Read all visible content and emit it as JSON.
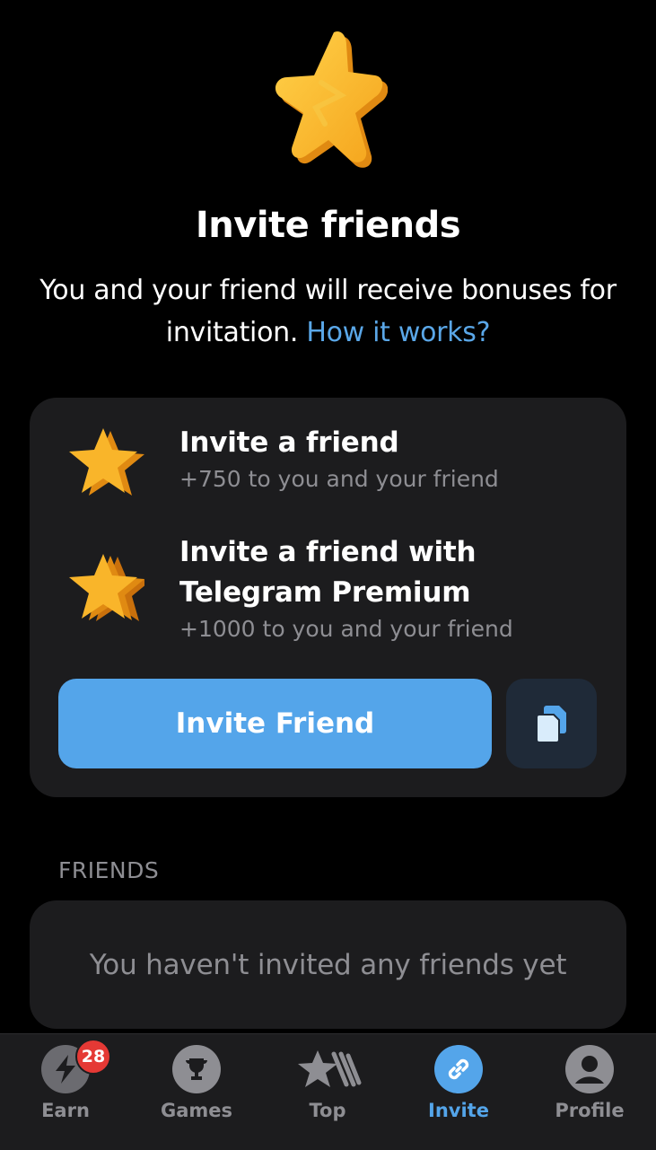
{
  "header": {
    "title": "Invite friends",
    "subtitle": "You and your friend will receive bonuses for invitation.",
    "link_text": "How it works?"
  },
  "rewards": [
    {
      "icon": "star-icon",
      "title": "Invite a friend",
      "description": "+750 to you and your friend"
    },
    {
      "icon": "premium-star-icon",
      "title": "Invite a friend with Telegram Premium",
      "description": "+1000 to you and your friend"
    }
  ],
  "actions": {
    "invite_label": "Invite Friend",
    "copy_icon": "copy-icon"
  },
  "friends": {
    "section_label": "FRIENDS",
    "empty_text": "You haven't invited any friends yet"
  },
  "tabs": [
    {
      "label": "Earn",
      "icon": "lightning-icon",
      "badge": "28"
    },
    {
      "label": "Games",
      "icon": "trophy-icon"
    },
    {
      "label": "Top",
      "icon": "star-top-icon"
    },
    {
      "label": "Invite",
      "icon": "link-icon",
      "active": true
    },
    {
      "label": "Profile",
      "icon": "profile-icon"
    }
  ],
  "colors": {
    "background": "#000000",
    "card": "#1c1c1e",
    "accent": "#54a5ea",
    "muted": "#8e8e93",
    "badge": "#e53935",
    "star": "#f9b52a"
  }
}
